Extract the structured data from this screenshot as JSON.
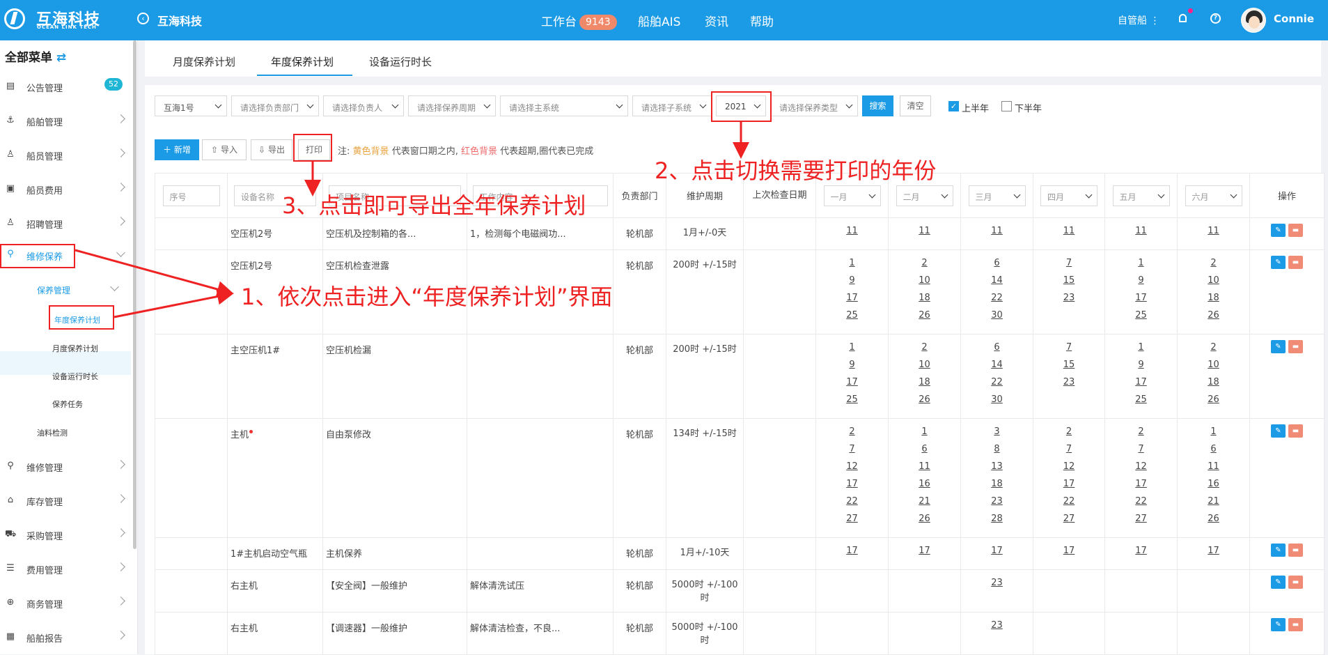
{
  "header": {
    "logo_cn": "互海科技",
    "logo_en": "OCEAN LINK TECH",
    "company": "互海科技",
    "nav": [
      {
        "label": "工作台",
        "badge": "9143"
      },
      {
        "label": "船舶AIS"
      },
      {
        "label": "资讯"
      },
      {
        "label": "帮助"
      }
    ],
    "org_label": "自管船",
    "user_name": "Connie"
  },
  "sidebar": {
    "title": "全部菜单",
    "items": [
      {
        "label": "公告管理",
        "icon": "book-icon",
        "badge": "52"
      },
      {
        "label": "船舶管理",
        "icon": "anchor-icon"
      },
      {
        "label": "船员管理",
        "icon": "person-icon"
      },
      {
        "label": "船员费用",
        "icon": "wallet-icon"
      },
      {
        "label": "招聘管理",
        "icon": "person-icon"
      },
      {
        "label": "维修保养",
        "icon": "wrench-icon"
      },
      {
        "label": "维修管理",
        "icon": "wrench-icon"
      },
      {
        "label": "库存管理",
        "icon": "home-icon"
      },
      {
        "label": "采购管理",
        "icon": "cart-icon"
      },
      {
        "label": "费用管理",
        "icon": "database-icon"
      },
      {
        "label": "商务管理",
        "icon": "globe-icon"
      },
      {
        "label": "船舶报告",
        "icon": "calendar-icon"
      }
    ],
    "sub_group": "保养管理",
    "sub_items": [
      "年度保养计划",
      "月度保养计划",
      "设备运行时长",
      "保养任务"
    ],
    "oil": "油料检测"
  },
  "tabs": [
    "月度保养计划",
    "年度保养计划",
    "设备运行时长"
  ],
  "filters": {
    "ship": "互海1号",
    "dept": "请选择负责部门",
    "person": "请选择负责人",
    "cycle": "请选择保养周期",
    "main_system": "请选择主系统",
    "sub_system": "请选择子系统",
    "year": "2021",
    "type": "请选择保养类型",
    "search": "搜索",
    "clear": "清空",
    "first_half": "上半年",
    "second_half": "下半年"
  },
  "actions": {
    "add": "新增",
    "import": "导入",
    "export": "导出",
    "print": "打印",
    "note_prefix": "注:",
    "yellow": "黄色背景",
    "note_mid": "代表窗口期之内,",
    "red": "红色背景",
    "note_end": "代表超期,圈代表已完成"
  },
  "table": {
    "headers": {
      "seq": "序号",
      "device": "设备名称",
      "item": "项目名称",
      "content": "工作内容",
      "dept": "负责部门",
      "cycle": "维护周期",
      "last_check": "上次检查日期",
      "months": [
        "一月",
        "二月",
        "三月",
        "四月",
        "五月",
        "六月"
      ],
      "op": "操作"
    },
    "rows": [
      {
        "device": "空压机2号",
        "item": "空压机及控制箱的各...",
        "content": "1，检测每个电磁阀功...",
        "dept": "轮机部",
        "cycle": "1月+/-0天",
        "months": [
          [
            "11"
          ],
          [
            "11"
          ],
          [
            "11"
          ],
          [
            "11"
          ],
          [
            "11"
          ],
          [
            "11"
          ]
        ]
      },
      {
        "device": "空压机2号",
        "item": "空压机检查泄露",
        "content": "",
        "dept": "轮机部",
        "cycle": "200时 +/-15时",
        "months": [
          [
            "1",
            "9",
            "17",
            "25"
          ],
          [
            "2",
            "10",
            "18",
            "26"
          ],
          [
            "6",
            "14",
            "22",
            "30"
          ],
          [
            "7",
            "15",
            "23"
          ],
          [
            "1",
            "9",
            "17",
            "25"
          ],
          [
            "2",
            "10",
            "18",
            "26"
          ]
        ]
      },
      {
        "device": "主空压机1#",
        "item": "空压机检漏",
        "content": "",
        "dept": "轮机部",
        "cycle": "200时 +/-15时",
        "months": [
          [
            "1",
            "9",
            "17",
            "25"
          ],
          [
            "2",
            "10",
            "18",
            "26"
          ],
          [
            "6",
            "14",
            "22",
            "30"
          ],
          [
            "7",
            "15",
            "23"
          ],
          [
            "1",
            "9",
            "17",
            "25"
          ],
          [
            "2",
            "10",
            "18",
            "26"
          ]
        ]
      },
      {
        "device": "主机",
        "item": "自由泵修改",
        "content": "",
        "dept": "轮机部",
        "cycle": "134时 +/-15时",
        "flag": true,
        "months": [
          [
            "2",
            "7",
            "12",
            "17",
            "22",
            "27"
          ],
          [
            "1",
            "6",
            "11",
            "16",
            "21",
            "26"
          ],
          [
            "3",
            "8",
            "13",
            "18",
            "23",
            "28"
          ],
          [
            "2",
            "7",
            "12",
            "17",
            "22",
            "27"
          ],
          [
            "2",
            "7",
            "12",
            "17",
            "22",
            "27"
          ],
          [
            "1",
            "6",
            "11",
            "16",
            "21",
            "26"
          ]
        ]
      },
      {
        "device": "1#主机启动空气瓶",
        "item": "主机保养",
        "content": "",
        "dept": "轮机部",
        "cycle": "1月+/-10天",
        "months": [
          [
            "17"
          ],
          [
            "17"
          ],
          [
            "17"
          ],
          [
            "17"
          ],
          [
            "17"
          ],
          [
            "17"
          ]
        ]
      },
      {
        "device": "右主机",
        "item": "【安全阀】一般维护",
        "content": "解体清洗试压",
        "dept": "轮机部",
        "cycle": "5000时 +/-100时",
        "months": [
          [],
          [],
          [
            "23"
          ],
          [],
          [],
          []
        ]
      },
      {
        "device": "右主机",
        "item": "【调速器】一般维护",
        "content": "解体清洁检查，不良...",
        "dept": "轮机部",
        "cycle": "5000时 +/-100时",
        "months": [
          [],
          [],
          [
            "23"
          ],
          [],
          [],
          []
        ]
      }
    ]
  },
  "annotations": {
    "a1": "1、依次点击进入“年度保养计划”界面",
    "a2": "2、点击切换需要打印的年份",
    "a3": "3、点击即可导出全年保养计划"
  },
  "colors": {
    "primary": "#1b9be6",
    "annotation": "#ee2222",
    "delete": "#f08c76"
  }
}
